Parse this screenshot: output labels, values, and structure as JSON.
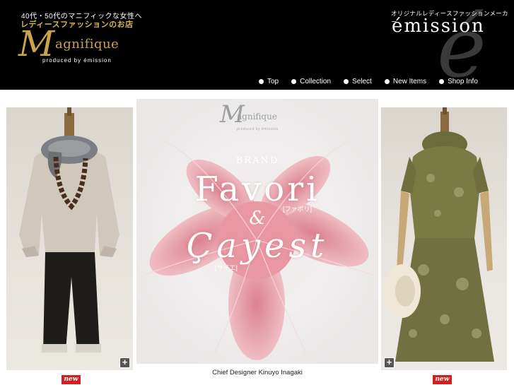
{
  "header": {
    "tagline_jp": "40代・50代のマニフィックな女性へ",
    "tagline_jp2": "レディースファッションのお店",
    "logo": {
      "initial": "M",
      "rest": "agnifique",
      "sub": "produced by émission"
    },
    "emission": {
      "tag": "オリジナルレディースファッションメーカー",
      "word": "émission",
      "big_letter": "é"
    }
  },
  "nav": {
    "items": [
      {
        "label": "Top"
      },
      {
        "label": "Collection"
      },
      {
        "label": "Select"
      },
      {
        "label": "New Items"
      },
      {
        "label": "Shop Info"
      }
    ]
  },
  "banner": {
    "logo_initial": "M",
    "logo_rest": "agnifique",
    "logo_sub": "produced by émission",
    "brand": "BRAND",
    "favori": "Favori",
    "favori_kana": "[ファボリ]",
    "amp": "&",
    "cayest": "Çayest",
    "cayest_kana": "[サイエ]"
  },
  "caption": "Chief Designer Kinuyo Inagaki",
  "buttons": {
    "plus": "+",
    "new": "new"
  },
  "colors": {
    "header_bg": "#000000",
    "gold": "#c9a548",
    "new_badge": "#d21e1e"
  }
}
